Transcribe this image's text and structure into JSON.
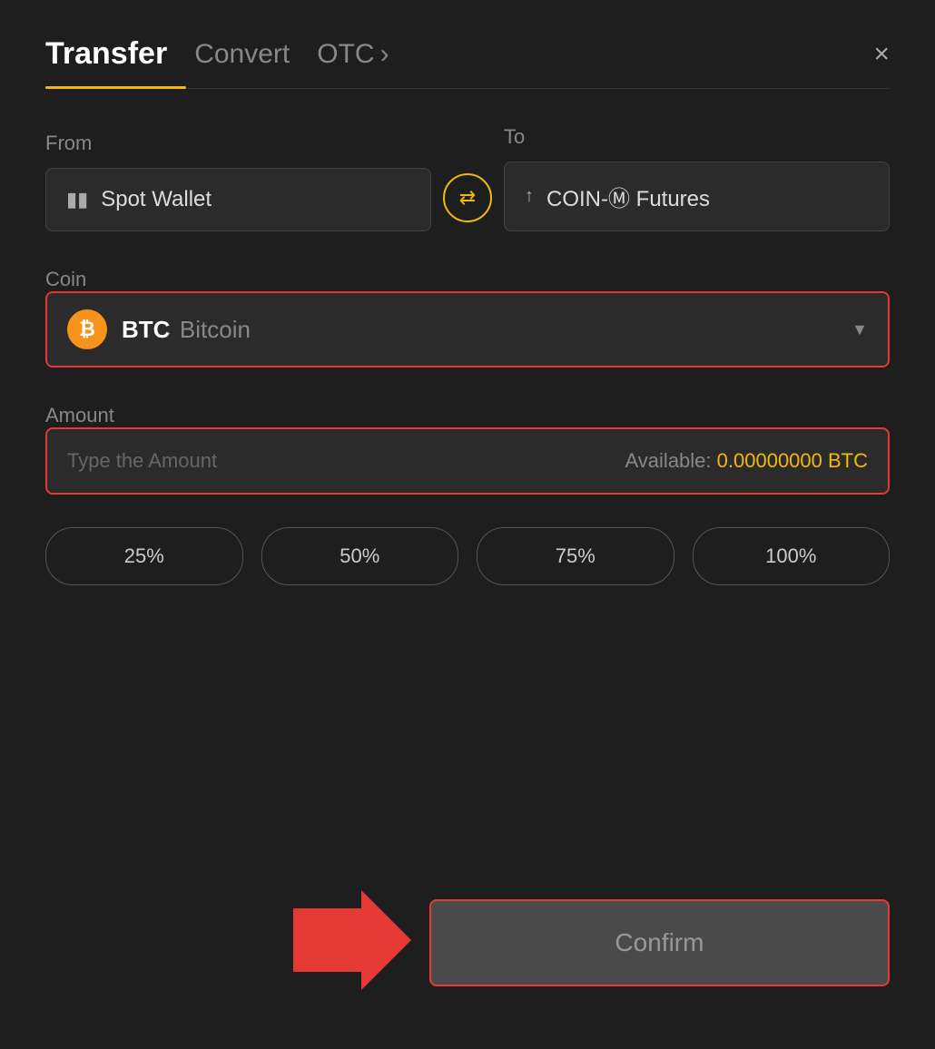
{
  "header": {
    "tab_transfer": "Transfer",
    "tab_convert": "Convert",
    "tab_otc": "OTC",
    "tab_otc_chevron": "›",
    "close_label": "×"
  },
  "from": {
    "label": "From",
    "wallet_icon": "▬",
    "wallet_text": "Spot Wallet"
  },
  "swap": {
    "icon": "⇄"
  },
  "to": {
    "label": "To",
    "wallet_icon": "↑",
    "wallet_text": "COIN-Ⓜ Futures"
  },
  "coin": {
    "label": "Coin",
    "symbol": "BTC",
    "fullname": "Bitcoin",
    "btc_letter": "₿"
  },
  "amount": {
    "label": "Amount",
    "placeholder": "Type the Amount",
    "available_label": "Available:",
    "available_value": "0.00000000 BTC"
  },
  "percent_buttons": [
    {
      "label": "25%"
    },
    {
      "label": "50%"
    },
    {
      "label": "75%"
    },
    {
      "label": "100%"
    }
  ],
  "confirm": {
    "label": "Confirm"
  },
  "colors": {
    "accent_yellow": "#f0b90b",
    "accent_red": "#e53935",
    "bg_dark": "#1e1e1e",
    "bg_input": "#2b2b2b"
  }
}
